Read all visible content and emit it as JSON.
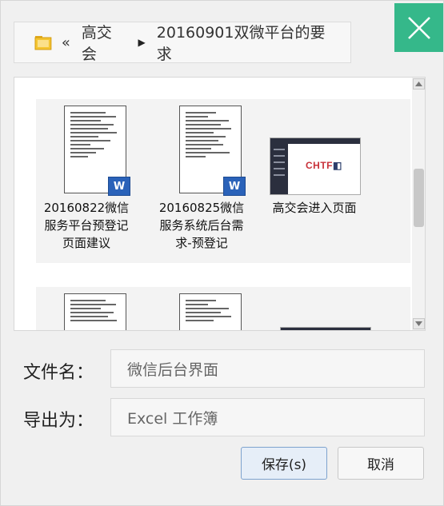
{
  "dialog": {
    "breadcrumb": {
      "back_symbol": "«",
      "parent": "高交会",
      "current": "20160901双微平台的要求"
    },
    "files": [
      {
        "name": "20160822微信服务平台预登记页面建议",
        "lines": [
          "20160822微信",
          "服务平台预登记",
          "页面建议"
        ],
        "type": "word"
      },
      {
        "name": "20160825微信服务系统后台需求-预登记",
        "lines": [
          "20160825微信",
          "服务系统后台需",
          "求-预登记"
        ],
        "type": "word"
      },
      {
        "name": "高交会进入页面",
        "lines": [
          "高交会进入页面"
        ],
        "type": "ppt"
      }
    ],
    "thumb_logo": {
      "text": "CHTF",
      "mark": "◧"
    },
    "filename": {
      "label": "文件名：",
      "value": "微信后台界面"
    },
    "export_as": {
      "label": "导出为：",
      "value": "Excel 工作簿"
    },
    "buttons": {
      "save": "保存(s)",
      "cancel": "取消"
    },
    "icons": {
      "close": "close-icon",
      "folder": "folder-icon",
      "word": "word-doc-icon"
    },
    "colors": {
      "close_bg": "#35b88a",
      "word_badge": "#2a62b9",
      "save_border": "#7da2ce"
    }
  }
}
